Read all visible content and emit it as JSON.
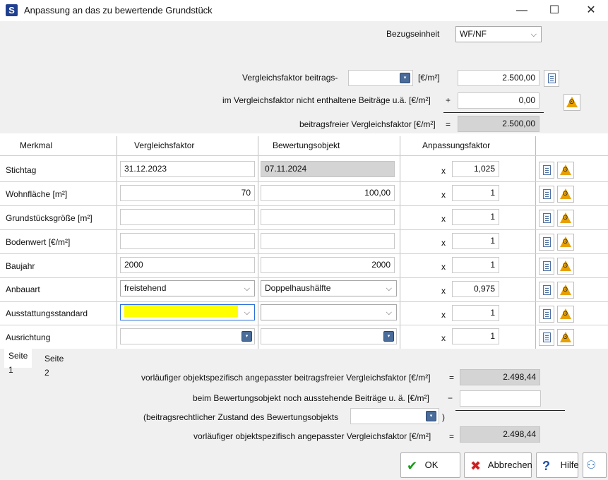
{
  "window": {
    "title": "Anpassung an das zu bewertende Grundstück",
    "app_letter": "S",
    "controls": {
      "minimize": "—",
      "maximize": "☐",
      "close": "✕"
    }
  },
  "header": {
    "bezugseinheit_label": "Bezugseinheit",
    "bezugseinheit_value": "WF/NF",
    "vf_label": "Vergleichsfaktor beitrags-",
    "vf_unit": "[€/m²]",
    "vf_value": "2.500,00",
    "not_included_label": "im Vergleichsfaktor nicht enthaltene Beiträge u.ä. [€/m²]",
    "plus": "+",
    "not_included_value": "0,00",
    "free_label": "beitragsfreier Vergleichsfaktor [€/m²]",
    "equals": "=",
    "free_value": "2.500,00"
  },
  "table": {
    "columns": [
      "Merkmal",
      "Vergleichsfaktor",
      "Bewertungsobjekt",
      "Anpassungsfaktor"
    ],
    "times": "x",
    "rows": [
      {
        "merkmal": "Stichtag",
        "vf": "31.12.2023",
        "bo": "07.11.2024",
        "af": "1,025"
      },
      {
        "merkmal": "Wohnfläche [m²]",
        "vf": "70",
        "bo": "100,00",
        "af": "1"
      },
      {
        "merkmal": "Grundstücksgröße [m²]",
        "vf": "",
        "bo": "",
        "af": "1"
      },
      {
        "merkmal": "Bodenwert [€/m²]",
        "vf": "",
        "bo": "",
        "af": "1"
      },
      {
        "merkmal": "Baujahr",
        "vf": "2000",
        "bo": "2000",
        "af": "1"
      },
      {
        "merkmal": "Anbauart",
        "vf": "freistehend",
        "bo": "Doppelhaushälfte",
        "af": "0,975"
      },
      {
        "merkmal": "Ausstattungsstandard",
        "vf": "",
        "bo": "",
        "af": "1"
      },
      {
        "merkmal": "Ausrichtung",
        "vf": "",
        "bo": "",
        "af": "1"
      }
    ]
  },
  "tabs": [
    "Seite 1",
    "Seite 2"
  ],
  "footer": {
    "prelim_free_label": "vorläufiger objektspezifisch angepasster beitragsfreier Vergleichsfaktor [€/m²]",
    "prelim_free_value": "2.498,44",
    "pending_label": "beim Bewertungsobjekt noch ausstehende Beiträge u. ä. [€/m²]",
    "minus": "−",
    "pending_value": "",
    "state_label": "(beitragsrechtlicher Zustand des Bewertungsobjekts",
    "state_close": ")",
    "prelim_label": "vorläufiger objektspezifisch angepasster Vergleichsfaktor [€/m²]",
    "prelim_value": "2.498,44"
  },
  "buttons": {
    "ok": "OK",
    "cancel": "Abbrechen",
    "help": "Hilfe"
  },
  "colors": {
    "highlight": "#ffff00",
    "readonly": "#d4d4d4"
  }
}
